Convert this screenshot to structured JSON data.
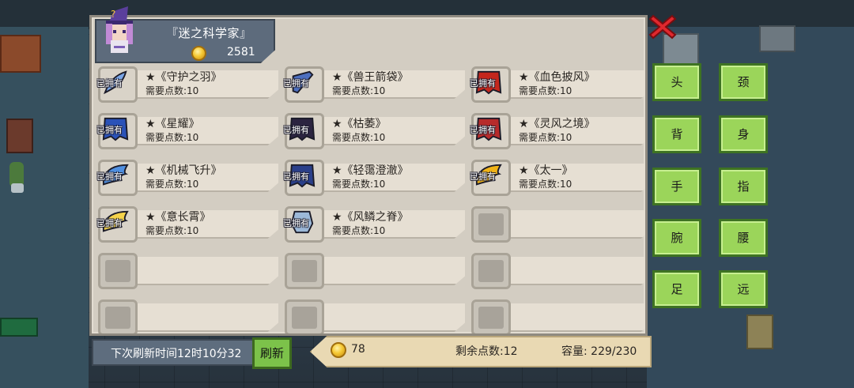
{
  "character": {
    "name": "『迷之科学家』",
    "gold": "2581",
    "avatar": "witch-avatar-icon"
  },
  "items": [
    {
      "owned_label": "已拥有",
      "name": "★《守护之羽》",
      "cost": "需要点数:10",
      "icon": "feather-icon",
      "color": "#7aa6e8"
    },
    {
      "owned_label": "已拥有",
      "name": "★《兽王箭袋》",
      "cost": "需要点数:10",
      "icon": "quiver-icon",
      "color": "#4d6fbf"
    },
    {
      "owned_label": "已拥有",
      "name": "★《血色披风》",
      "cost": "需要点数:10",
      "icon": "cape-icon",
      "color": "#c4271d"
    },
    {
      "owned_label": "已拥有",
      "name": "★《星耀》",
      "cost": "需要点数:10",
      "icon": "cape-icon",
      "color": "#2a52b8"
    },
    {
      "owned_label": "已拥有",
      "name": "★《枯萎》",
      "cost": "需要点数:10",
      "icon": "cape-icon",
      "color": "#2b2440"
    },
    {
      "owned_label": "已拥有",
      "name": "★《灵风之境》",
      "cost": "需要点数:10",
      "icon": "cape-icon",
      "color": "#b72b2b"
    },
    {
      "owned_label": "已拥有",
      "name": "★《机械飞升》",
      "cost": "需要点数:10",
      "icon": "wing-icon",
      "color": "#4f8fe0"
    },
    {
      "owned_label": "已拥有",
      "name": "★《轻霭澄澈》",
      "cost": "需要点数:10",
      "icon": "cape-icon",
      "color": "#2a3f8a"
    },
    {
      "owned_label": "已拥有",
      "name": "★《太一》",
      "cost": "需要点数:10",
      "icon": "wing-icon",
      "color": "#f0b317"
    },
    {
      "owned_label": "已拥有",
      "name": "★《意长霄》",
      "cost": "需要点数:10",
      "icon": "wing-icon",
      "color": "#f4d24a"
    },
    {
      "owned_label": "已拥有",
      "name": "★《风鳞之脊》",
      "cost": "需要点数:10",
      "icon": "scarf-icon",
      "color": "#9cb8d8"
    },
    {
      "owned_label": "",
      "name": "",
      "cost": "",
      "icon": "empty-slot",
      "color": ""
    },
    {
      "owned_label": "",
      "name": "",
      "cost": "",
      "icon": "empty-slot",
      "color": ""
    },
    {
      "owned_label": "",
      "name": "",
      "cost": "",
      "icon": "empty-slot",
      "color": ""
    },
    {
      "owned_label": "",
      "name": "",
      "cost": "",
      "icon": "empty-slot",
      "color": ""
    },
    {
      "owned_label": "",
      "name": "",
      "cost": "",
      "icon": "empty-slot",
      "color": ""
    },
    {
      "owned_label": "",
      "name": "",
      "cost": "",
      "icon": "empty-slot",
      "color": ""
    },
    {
      "owned_label": "",
      "name": "",
      "cost": "",
      "icon": "empty-slot",
      "color": ""
    }
  ],
  "footer": {
    "refresh_time": "下次刷新时间12时10分32",
    "refresh_button": "刷新",
    "gold": "78",
    "remaining_points": "剩余点数:12",
    "capacity": "容量: 229/230"
  },
  "slots": [
    "头",
    "颈",
    "背",
    "身",
    "手",
    "指",
    "腕",
    "腰",
    "足",
    "远"
  ],
  "colors": {
    "panel": "#d3cdc2",
    "slot_button": "#9bd55a",
    "close": "#e0282e"
  }
}
